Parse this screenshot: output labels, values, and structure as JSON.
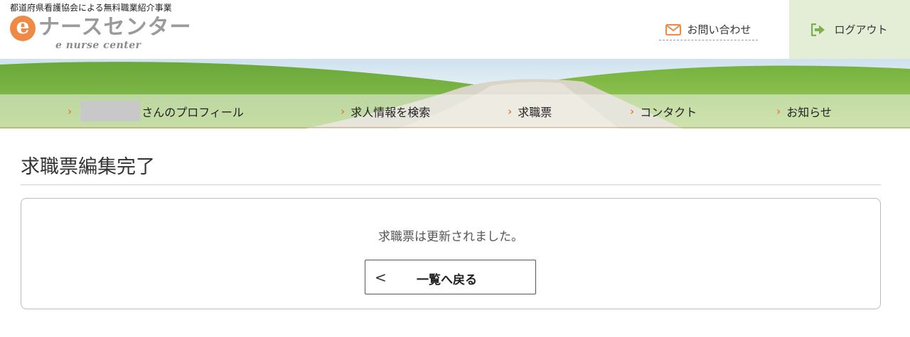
{
  "header": {
    "tagline": "都道府県看護協会による無料職業紹介事業",
    "logo_mark": "e",
    "logo_text": "ナースセンター",
    "logo_sub": "e nurse center",
    "contact_label": "お問い合わせ",
    "contact_icon": "envelope-icon",
    "logout_label": "ログアウト",
    "logout_icon": "sign-out-icon",
    "colors": {
      "accent": "#ee8a45",
      "logout_bg": "#e4edd6"
    }
  },
  "nav": {
    "items": [
      {
        "label": "さんのプロフィール"
      },
      {
        "label": "求人情報を検索"
      },
      {
        "label": "求職票"
      },
      {
        "label": "コンタクト"
      },
      {
        "label": "お知らせ"
      }
    ]
  },
  "main": {
    "title": "求職票編集完了",
    "message": "求職票は更新されました。",
    "back_button_icon": "<",
    "back_button_label": "一覧へ戻る"
  }
}
